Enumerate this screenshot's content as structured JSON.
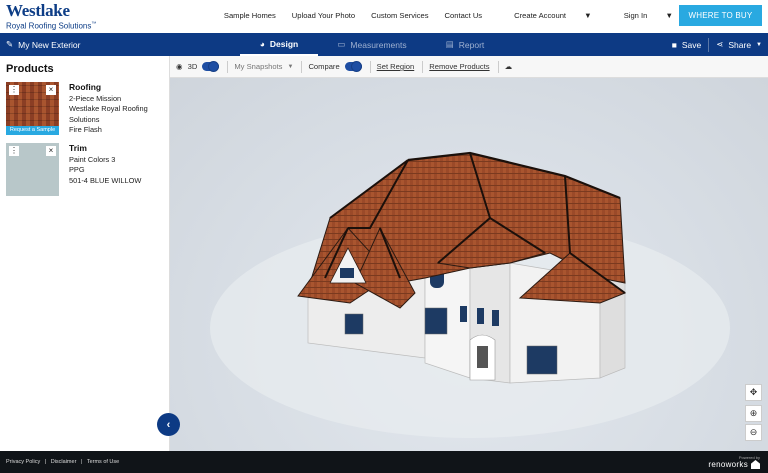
{
  "brand": {
    "name": "Westlake",
    "sub": "Royal Roofing Solutions",
    "tm": "™"
  },
  "nav": {
    "links": [
      "Sample Homes",
      "Upload Your Photo",
      "Custom Services",
      "Contact Us",
      "Create Account",
      "Sign In"
    ],
    "buy_label": "WHERE TO BUY"
  },
  "toolbar": {
    "project_name": "My New Exterior",
    "tabs": [
      {
        "label": "Design",
        "active": true
      },
      {
        "label": "Measurements",
        "active": false
      },
      {
        "label": "Report",
        "active": false
      }
    ],
    "save_label": "Save",
    "share_label": "Share"
  },
  "sidebar": {
    "title": "Products",
    "products": [
      {
        "category": "Roofing",
        "lines": [
          "2-Piece Mission",
          "Westlake Royal Roofing",
          "Solutions",
          "Fire Flash"
        ],
        "sample_label": "Request a Sample"
      },
      {
        "category": "Trim",
        "lines": [
          "Paint Colors 3",
          "PPG",
          "501-4 BLUE WILLOW"
        ]
      }
    ]
  },
  "subtoolbar": {
    "threed_label": "3D",
    "snapshots_label": "My Snapshots",
    "compare_label": "Compare",
    "set_region_label": "Set Region",
    "remove_products_label": "Remove Products"
  },
  "footer": {
    "links": [
      "Privacy Policy",
      "|",
      "Disclaimer",
      "|",
      "Terms of Use"
    ],
    "powered_by": "Powered by",
    "vendor": "renoworks"
  },
  "colors": {
    "accent": "#29a9e1",
    "navy": "#0d3a84",
    "roof": "#a9552f",
    "wall": "#f2f2f2"
  }
}
